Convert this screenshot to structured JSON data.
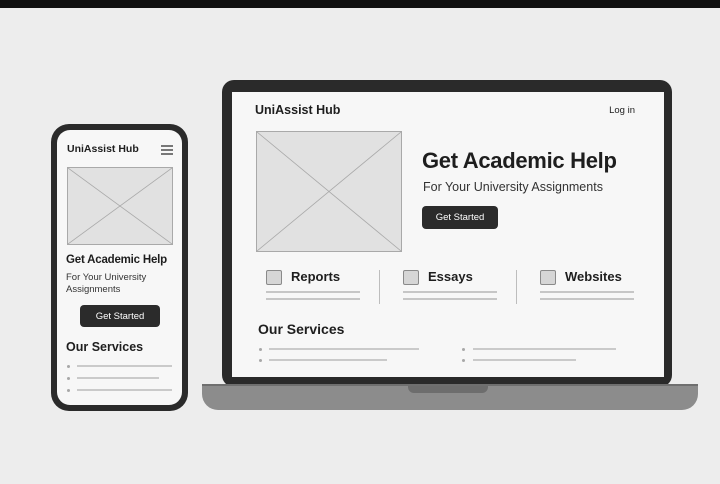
{
  "laptop": {
    "brand": "UniAssist Hub",
    "login": "Log in",
    "hero": {
      "title": "Get Academic Help",
      "subtitle": "For Your University Assignments",
      "cta": "Get Started"
    },
    "features": [
      {
        "label": "Reports"
      },
      {
        "label": "Essays"
      },
      {
        "label": "Websites"
      }
    ],
    "services_heading": "Our Services"
  },
  "phone": {
    "brand": "UniAssist Hub",
    "menu_icon": "hamburger-menu-icon",
    "hero": {
      "title": "Get Academic Help",
      "subtitle": "For Your University Assignments",
      "cta": "Get Started"
    },
    "services_heading": "Our Services"
  },
  "colors": {
    "background": "#ededed",
    "device_frame": "#2a2a2a",
    "screen": "#f7f7f7",
    "button": "#2b2b2b",
    "placeholder": "#e1e1e1"
  }
}
